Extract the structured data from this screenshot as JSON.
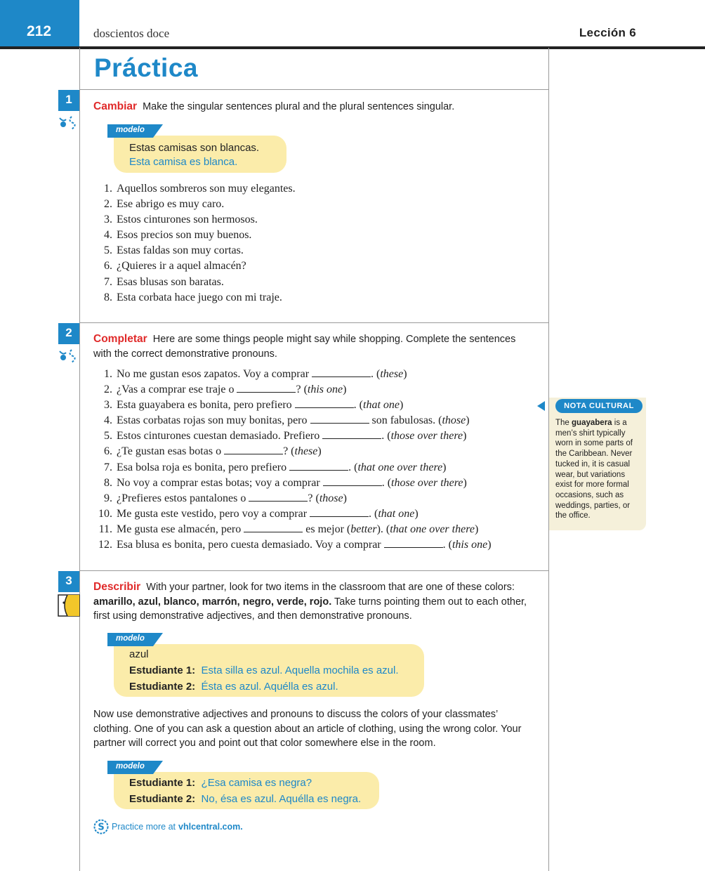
{
  "header": {
    "page_number": "212",
    "page_words": "doscientos doce",
    "lesson": "Lección 6"
  },
  "title": "Práctica",
  "activity1": {
    "number": "1",
    "keyword": "Cambiar",
    "instruction": "Make the singular sentences plural and the plural sentences singular.",
    "modelo_label": "modelo",
    "modelo_prompt": "Estas camisas son blancas.",
    "modelo_answer": "Esta camisa es blanca.",
    "items": [
      {
        "n": "1.",
        "text": "Aquellos sombreros son muy elegantes."
      },
      {
        "n": "2.",
        "text": "Ese abrigo es muy caro."
      },
      {
        "n": "3.",
        "text": "Estos cinturones son hermosos."
      },
      {
        "n": "4.",
        "text": "Esos precios son muy buenos."
      },
      {
        "n": "5.",
        "text": "Estas faldas son muy cortas."
      },
      {
        "n": "6.",
        "text": "¿Quieres ir a aquel almacén?"
      },
      {
        "n": "7.",
        "text": "Esas blusas son baratas."
      },
      {
        "n": "8.",
        "text": "Esta corbata hace juego con mi traje."
      }
    ]
  },
  "activity2": {
    "number": "2",
    "keyword": "Completar",
    "instruction": "Here are some things people might say while shopping. Complete the sentences with the correct demonstrative pronouns.",
    "items": [
      {
        "n": "1.",
        "a": "No me gustan esos zapatos. Voy a comprar",
        "b": ". (",
        "hint": "these",
        "c": ")"
      },
      {
        "n": "2.",
        "a": "¿Vas a comprar ese traje o",
        "b": "? (",
        "hint": "this one",
        "c": ")"
      },
      {
        "n": "3.",
        "a": "Esta guayabera es bonita, pero prefiero",
        "b": ". (",
        "hint": "that one",
        "c": ")"
      },
      {
        "n": "4.",
        "a": "Estas corbatas rojas son muy bonitas, pero",
        "b": " son fabulosas. (",
        "hint": "those",
        "c": ")"
      },
      {
        "n": "5.",
        "a": "Estos cinturones cuestan demasiado. Prefiero",
        "b": ". (",
        "hint": "those over there",
        "c": ")"
      },
      {
        "n": "6.",
        "a": "¿Te gustan esas botas o",
        "b": "? (",
        "hint": "these",
        "c": ")"
      },
      {
        "n": "7.",
        "a": "Esa bolsa roja es bonita, pero prefiero",
        "b": ". (",
        "hint": "that one over there",
        "c": ")"
      },
      {
        "n": "8.",
        "a": "No voy a comprar estas botas; voy a comprar",
        "b": ". (",
        "hint": "those over there",
        "c": ")"
      },
      {
        "n": "9.",
        "a": "¿Prefieres estos pantalones o",
        "b": "? (",
        "hint": "those",
        "c": ")"
      },
      {
        "n": "10.",
        "a": "Me gusta este vestido, pero voy a comprar",
        "b": ". (",
        "hint": "that one",
        "c": ")"
      },
      {
        "n": "11.",
        "a": "Me gusta ese almacén, pero",
        "b": " es mejor (",
        "hint": "better",
        "c": "). (",
        "hint2": "that one over there",
        "d": ")"
      },
      {
        "n": "12.",
        "a": "Esa blusa es bonita, pero cuesta demasiado. Voy a comprar",
        "b": ". (",
        "hint": "this one",
        "c": ")"
      }
    ]
  },
  "activity3": {
    "number": "3",
    "keyword": "Describir",
    "instruction_a": "With your partner, look for two items in the classroom that are one of these colors:",
    "colors": "amarillo, azul, blanco, marrón, negro, verde, rojo.",
    "instruction_b": "Take turns pointing them out to each other, first using demonstrative adjectives, and then demonstrative pronouns.",
    "modelo1": {
      "label": "modelo",
      "prompt": "azul",
      "s1_label": "Estudiante 1:",
      "s1": "Esta silla es azul. Aquella mochila es azul.",
      "s2_label": "Estudiante 2:",
      "s2": "Ésta es azul. Aquélla es azul."
    },
    "paragraph": "Now use demonstrative adjectives and pronouns to discuss the colors of your classmates’ clothing. One of you can ask a question about an article of clothing, using the wrong color. Your partner will correct you and point out that color somewhere else in the room.",
    "modelo2": {
      "label": "modelo",
      "s1_label": "Estudiante 1:",
      "s1": "¿Esa camisa es negra?",
      "s2_label": "Estudiante 2:",
      "s2": "No, ésa es azul. Aquélla es negra."
    }
  },
  "nota_cultural": {
    "label": "NOTA CULTURAL",
    "text_a": "The",
    "term": "guayabera",
    "text_b": "is a men’s shirt typically worn in some parts of the Caribbean. Never tucked in, it is casual wear, but variations exist for more formal occasions, such as weddings, parties, or the office."
  },
  "practice": {
    "text": "Practice more at",
    "site": "vhlcentral.com."
  },
  "colors": {
    "accent_blue": "#1e88c8",
    "keyword_red": "#e02a2a",
    "modelo_yellow": "#fbecaa",
    "sidebar_bg": "#f5f0da"
  }
}
